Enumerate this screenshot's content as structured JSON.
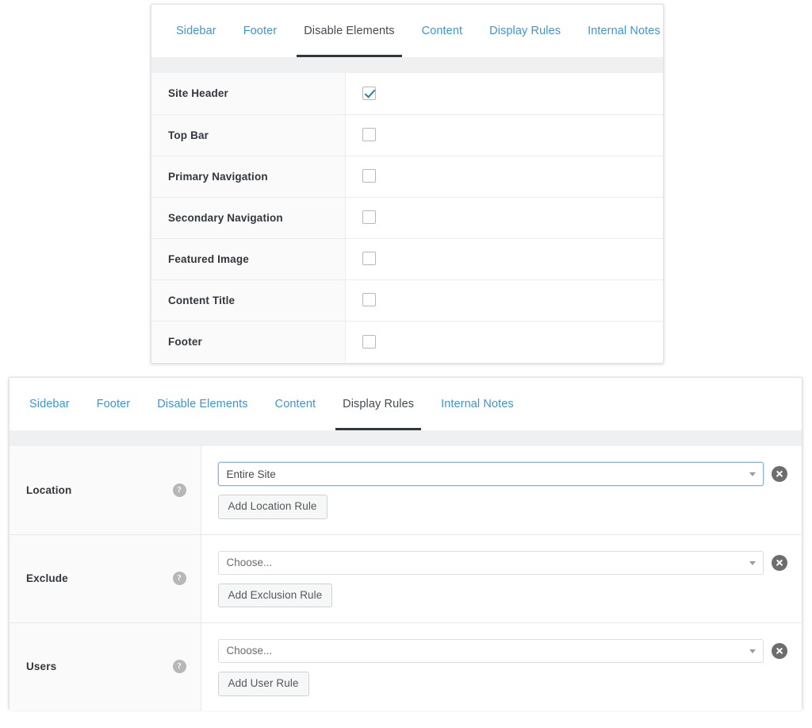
{
  "panel_elements": {
    "tabs": [
      {
        "label": "Sidebar",
        "active": false
      },
      {
        "label": "Footer",
        "active": false
      },
      {
        "label": "Disable Elements",
        "active": true
      },
      {
        "label": "Content",
        "active": false
      },
      {
        "label": "Display Rules",
        "active": false
      },
      {
        "label": "Internal Notes",
        "active": false
      }
    ],
    "rows": [
      {
        "label": "Site Header",
        "checked": true
      },
      {
        "label": "Top Bar",
        "checked": false
      },
      {
        "label": "Primary Navigation",
        "checked": false
      },
      {
        "label": "Secondary Navigation",
        "checked": false
      },
      {
        "label": "Featured Image",
        "checked": false
      },
      {
        "label": "Content Title",
        "checked": false
      },
      {
        "label": "Footer",
        "checked": false
      }
    ]
  },
  "panel_display_rules": {
    "tabs": [
      {
        "label": "Sidebar",
        "active": false
      },
      {
        "label": "Footer",
        "active": false
      },
      {
        "label": "Disable Elements",
        "active": false
      },
      {
        "label": "Content",
        "active": false
      },
      {
        "label": "Display Rules",
        "active": true
      },
      {
        "label": "Internal Notes",
        "active": false
      }
    ],
    "rows": [
      {
        "label": "Location",
        "help_icon": "question-mark-icon",
        "select_value": "Entire Site",
        "select_focused": true,
        "clear_icon": "clear-circle-x-icon",
        "button_label": "Add Location Rule"
      },
      {
        "label": "Exclude",
        "help_icon": "question-mark-icon",
        "select_value": "Choose...",
        "select_focused": false,
        "clear_icon": "clear-circle-x-icon",
        "button_label": "Add Exclusion Rule"
      },
      {
        "label": "Users",
        "help_icon": "question-mark-icon",
        "select_value": "Choose...",
        "select_focused": false,
        "clear_icon": "clear-circle-x-icon",
        "button_label": "Add User Rule"
      }
    ]
  },
  "icons": {
    "help": "?",
    "checkmark": "check-icon",
    "caret": "chevron-down-icon"
  },
  "colors": {
    "tab_link": "#3a97d4",
    "tab_active_text": "#444a4f",
    "tab_active_underline": "#32373c",
    "label_bg": "#fafafa",
    "checkmark": "#2e7ca8",
    "focus_border": "#8cb4e0",
    "clear_circle": "#6d6d6d",
    "help_circle": "#b7b7b7"
  }
}
